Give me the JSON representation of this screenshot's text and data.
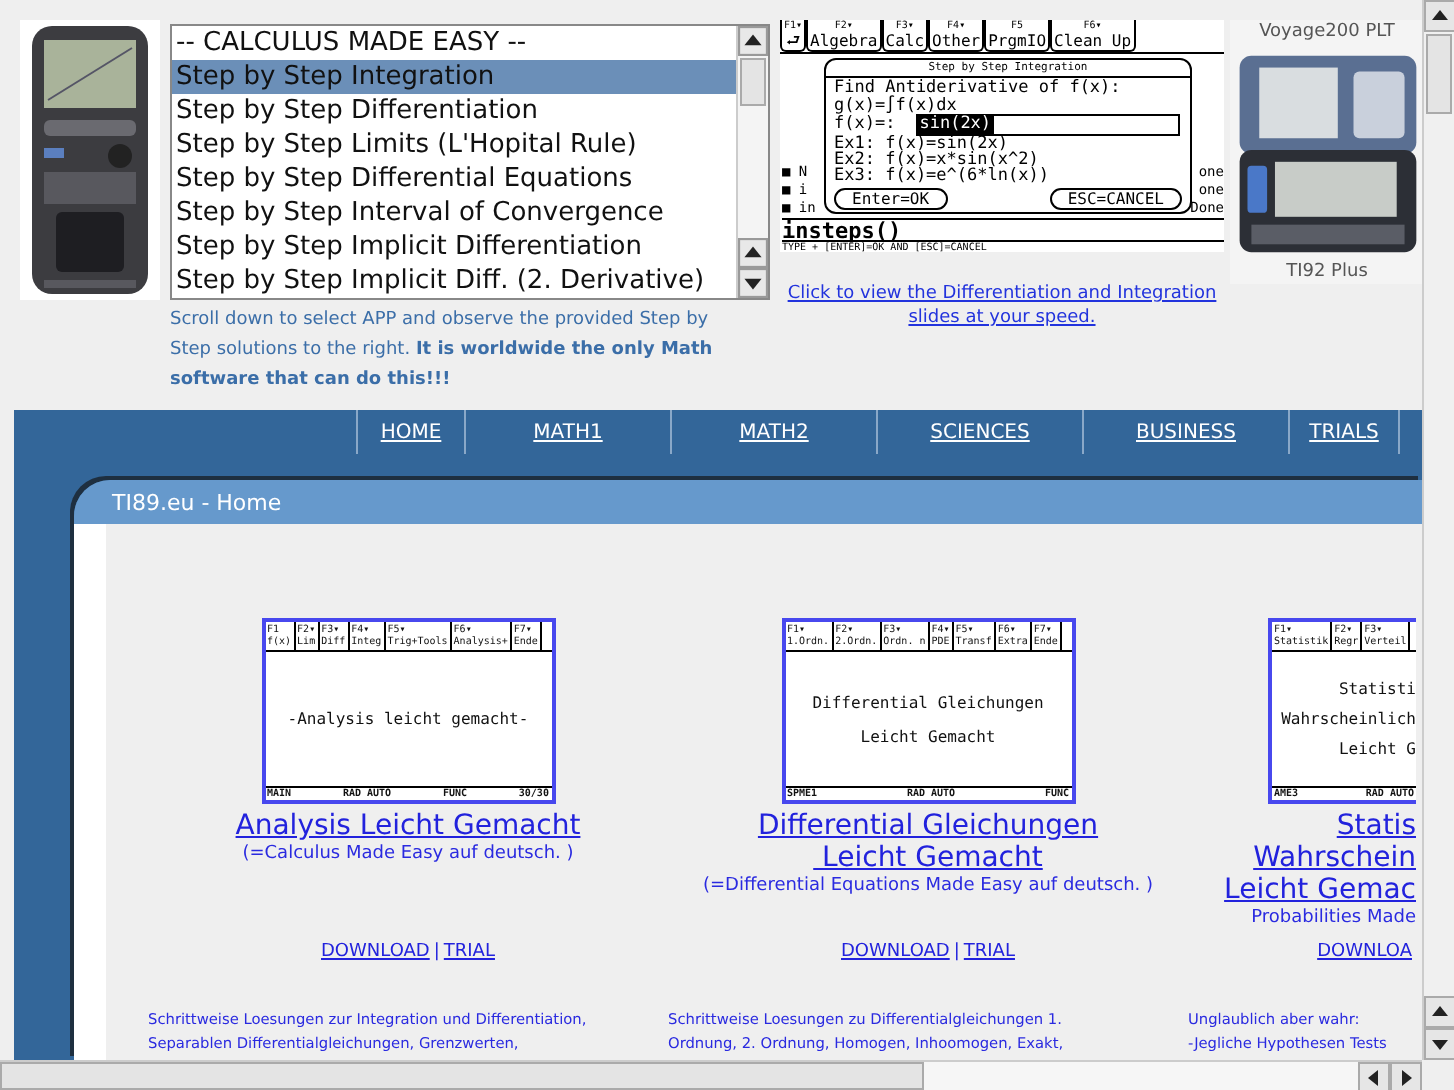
{
  "top": {
    "selector": {
      "items": [
        {
          "label": "-- CALCULUS MADE EASY --",
          "selected": false
        },
        {
          "label": "Step by Step Integration",
          "selected": true
        },
        {
          "label": "Step by Step Differentiation",
          "selected": false
        },
        {
          "label": "Step by Step Limits (L'Hopital Rule)",
          "selected": false
        },
        {
          "label": "Step by Step Differential Equations",
          "selected": false
        },
        {
          "label": "Step by Step Interval of Convergence",
          "selected": false
        },
        {
          "label": "Step by Step Implicit Differentiation",
          "selected": false
        },
        {
          "label": "Step by Step Implicit Diff. (2. Derivative)",
          "selected": false
        }
      ]
    },
    "hint": "Scroll down to select APP and observe the provided Step by Step solutions to the right. **It is worldwide the only Math software that can do this!!!**",
    "demo_screen": {
      "tabs": [
        {
          "key": "F1▾",
          "label": "⮐"
        },
        {
          "key": "F2▾",
          "label": "Algebra"
        },
        {
          "key": "F3▾",
          "label": "Calc"
        },
        {
          "key": "F4▾",
          "label": "Other"
        },
        {
          "key": "F5",
          "label": "PrgmIO"
        },
        {
          "key": "F6▾",
          "label": "Clean Up"
        }
      ],
      "history": [
        {
          "entry": "■ N",
          "result": "one"
        },
        {
          "entry": "■ i",
          "result": "one"
        },
        {
          "entry": "■ in",
          "result": "Done"
        }
      ],
      "dialog": {
        "title": "Step by Step Integration",
        "lines": [
          "Find Antiderivative of f(x):",
          "g(x)=∫f(x)dx"
        ],
        "input_label": "f(x)=:",
        "input_value": "sin(2x)",
        "examples": [
          "Ex1: f(x)=sin(2x)",
          "Ex2: f(x)=x*sin(x^2)",
          "Ex3: f(x)=e^(6*ln(x))"
        ],
        "buttons": [
          "Enter=OK",
          "ESC=CANCEL"
        ]
      },
      "entry": "insteps()",
      "status": "TYPE + [ENTER]=OK AND [ESC]=CANCEL"
    },
    "demo_link": "Click to view the Differentiation and Integration slides at your speed.",
    "device": {
      "caption_top": "Voyage200 PLT",
      "caption_bottom": "TI92 Plus"
    }
  },
  "nav": [
    {
      "label": "HOME"
    },
    {
      "label": "MATH1"
    },
    {
      "label": "MATH2"
    },
    {
      "label": "SCIENCES"
    },
    {
      "label": "BUSINESS"
    },
    {
      "label": "TRIALS"
    }
  ],
  "panel_title": "TI89.eu - Home",
  "cards": [
    {
      "screen": {
        "tabs": [
          {
            "key": "F1",
            "label": "f(x)"
          },
          {
            "key": "F2▾",
            "label": "Lim"
          },
          {
            "key": "F3▾",
            "label": "Diff"
          },
          {
            "key": "F4▾",
            "label": "Integ"
          },
          {
            "key": "F5▾",
            "label": "Trig+Tools"
          },
          {
            "key": "F6▾",
            "label": "Analysis+"
          },
          {
            "key": "F7▾",
            "label": "Ende"
          }
        ],
        "lines": [
          "-Analysis leicht gemacht-"
        ],
        "status": [
          "MAIN",
          "RAD AUTO",
          "FUNC",
          "30/30"
        ]
      },
      "title_lines": [
        "Analysis Leicht Gemacht"
      ],
      "subtitle": "(=Calculus Made Easy auf deutsch. )",
      "links": [
        "DOWNLOAD",
        "TRIAL"
      ],
      "separator": "|",
      "description": [
        "Schrittweise Loesungen zur Integration und Differentiation,",
        "Separablen Differentialgleichungen, Grenzwerten,"
      ]
    },
    {
      "screen": {
        "tabs": [
          {
            "key": "F1▾",
            "label": "1.Ordn."
          },
          {
            "key": "F2▾",
            "label": "2.Ordn."
          },
          {
            "key": "F3▾",
            "label": "Ordn. n"
          },
          {
            "key": "F4▾",
            "label": "PDE"
          },
          {
            "key": "F5▾",
            "label": "Transf"
          },
          {
            "key": "F6▾",
            "label": "Extra"
          },
          {
            "key": "F7▾",
            "label": "Ende"
          }
        ],
        "lines": [
          "Differential Gleichungen",
          "Leicht Gemacht"
        ],
        "status": [
          "SPME1",
          "RAD AUTO",
          "FUNC"
        ]
      },
      "title_lines": [
        "Differential Gleichungen",
        " Leicht Gemacht"
      ],
      "subtitle": "(=Differential Equations Made Easy auf deutsch. )",
      "links": [
        "DOWNLOAD",
        "TRIAL"
      ],
      "separator": "|",
      "description": [
        "Schrittweise Loesungen zu Differentialgleichungen 1.",
        "Ordnung, 2. Ordnung, Homogen, Inhoomogen, Exakt,"
      ]
    },
    {
      "screen": {
        "tabs": [
          {
            "key": "F1▾",
            "label": "Statistik"
          },
          {
            "key": "F2▾",
            "label": "Regr"
          },
          {
            "key": "F3▾",
            "label": "Verteil"
          }
        ],
        "lines": [
          "Statisti",
          "Wahrscheinlich",
          "Leicht G"
        ],
        "status": [
          "AME3",
          "RAD AUTO"
        ]
      },
      "title_lines": [
        "Statis",
        "Wahrschein",
        "Leicht Gemac"
      ],
      "subtitle": "Probabilities Made",
      "links": [
        "DOWNLOA"
      ],
      "description": [
        "Unglaublich aber wahr:",
        "-Jegliche Hypothesen Tests"
      ]
    }
  ]
}
